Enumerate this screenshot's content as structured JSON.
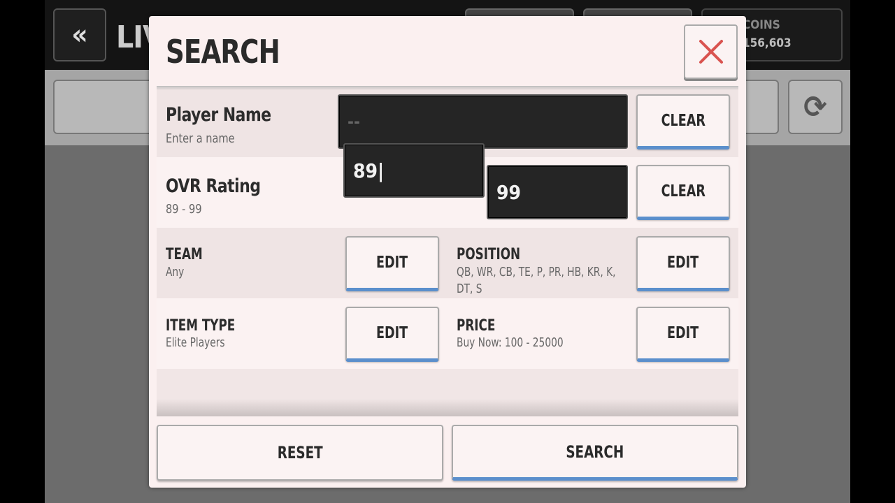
{
  "background": {
    "title": "LIV",
    "coins_label": "COINS",
    "coins_value": "156,603"
  },
  "modal": {
    "title": "SEARCH",
    "player_name": {
      "label": "Player Name",
      "hint": "Enter a name",
      "value": "--",
      "clear_label": "CLEAR"
    },
    "ovr_rating": {
      "label": "OVR Rating",
      "range": "89 - 99",
      "min_value": "89|",
      "max_value": "99",
      "clear_label": "CLEAR"
    },
    "team": {
      "label": "TEAM",
      "value": "Any",
      "edit_label": "EDIT"
    },
    "position": {
      "label": "POSITION",
      "value": "QB, WR, CB, TE, P, PR, HB, KR, K, DT, S",
      "edit_label": "EDIT"
    },
    "item_type": {
      "label": "ITEM TYPE",
      "value": "Elite Players",
      "edit_label": "EDIT"
    },
    "price": {
      "label": "PRICE",
      "value": "Buy Now: 100 - 25000",
      "edit_label": "EDIT"
    },
    "reset_label": "RESET",
    "search_label": "SEARCH"
  },
  "colors": {
    "accent": "#5b8fcc",
    "close_icon": "#d9534f",
    "modal_bg": "#fbf0f0"
  }
}
